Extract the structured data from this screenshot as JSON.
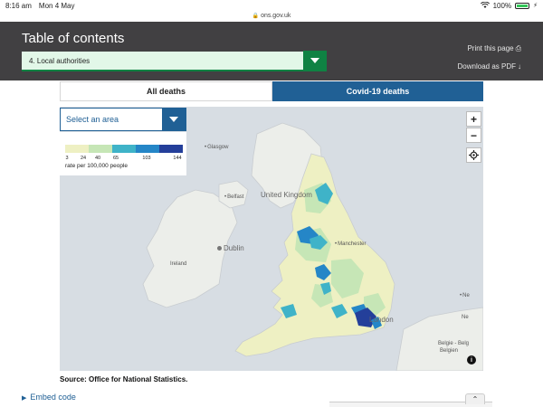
{
  "status_bar": {
    "time": "8:16 am",
    "date": "Mon 4 May",
    "battery": "100%"
  },
  "browser": {
    "url": "ons.gov.uk"
  },
  "toc": {
    "title": "Table of contents",
    "selected": "4. Local authorities",
    "print_label": "Print this page",
    "pdf_label": "Download as PDF"
  },
  "tabs": [
    {
      "label": "All deaths",
      "active": false
    },
    {
      "label": "Covid-19 deaths",
      "active": true
    }
  ],
  "map": {
    "select_placeholder": "Select an area",
    "legend": {
      "caption": "rate per 100,000 people",
      "breaks": [
        "3",
        "24",
        "40",
        "65",
        "103",
        "144"
      ],
      "colors": [
        "#eef0c3",
        "#c6e6b6",
        "#3fb3c8",
        "#2586c7",
        "#243f9a"
      ]
    },
    "labels": {
      "glasgow": "Glasgow",
      "belfast": "Belfast",
      "united_kingdom": "United Kingdom",
      "dublin": "Dublin",
      "ireland": "Ireland",
      "manchester": "Manchester",
      "london": "London",
      "nl": "Ne",
      "nl2": "Ne",
      "belgium": "Belgie - Belg",
      "belgium2": "Belgien"
    },
    "zoom_in": "+",
    "zoom_out": "−",
    "info": "i"
  },
  "source": "Source: Office for National Statistics.",
  "embed_label": "Embed code"
}
